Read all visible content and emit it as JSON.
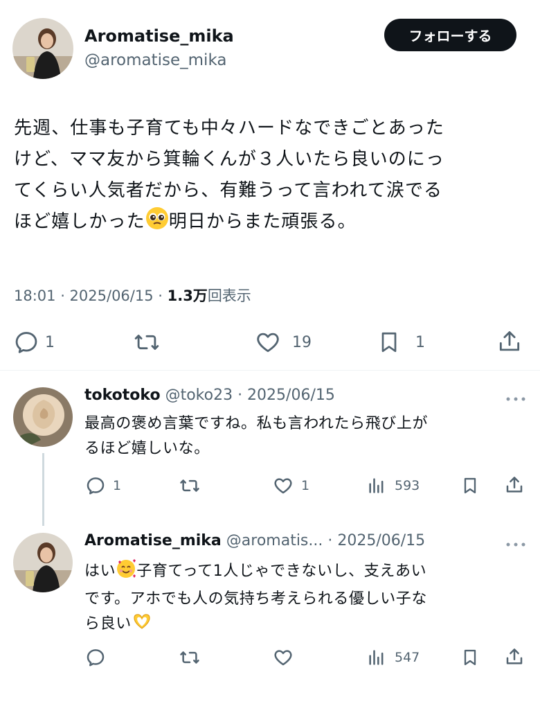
{
  "main_tweet": {
    "display_name": "Aromatise_mika",
    "handle": "@aromatise_mika",
    "follow_label": "フォローする",
    "text_lines": [
      "先週、仕事も子育ても中々ハードなできごとあった",
      "けど、ママ友から箕輪くんが３人いたら良いのにっ",
      "てくらい人気者だから、有難うって言われて涙でる",
      "ほど嬉しかった"
    ],
    "text_tail": "明日からまた頑張る。",
    "timestamp": "18:01 · 2025/06/15 · ",
    "views_count": "1.3万",
    "views_label": "回表示",
    "stats": {
      "replies": "1",
      "retweets": "",
      "likes": "19",
      "bookmarks": "1"
    }
  },
  "replies": [
    {
      "display_name": "tokotoko",
      "meta": "@toko23 · 2025/06/15",
      "text_lines": [
        "最高の褒め言葉ですね。私も言われたら飛び上が",
        "るほど嬉しいな。"
      ],
      "stats": {
        "replies": "1",
        "retweets": "",
        "likes": "1",
        "views": "593"
      }
    },
    {
      "display_name": "Aromatise_mika",
      "meta": "@aromatis... · 2025/06/15",
      "line1_a": "はい",
      "line1_b": "子育てって1人じゃできないし、支えあい",
      "line2": "です。アホでも人の気持ち考えられる優しい子な",
      "line3": "ら良い",
      "stats": {
        "replies": "",
        "retweets": "",
        "likes": "",
        "views": "547"
      }
    }
  ],
  "colors": {
    "text": "#0f1419",
    "secondary": "#536471",
    "divider": "#eff3f4"
  }
}
